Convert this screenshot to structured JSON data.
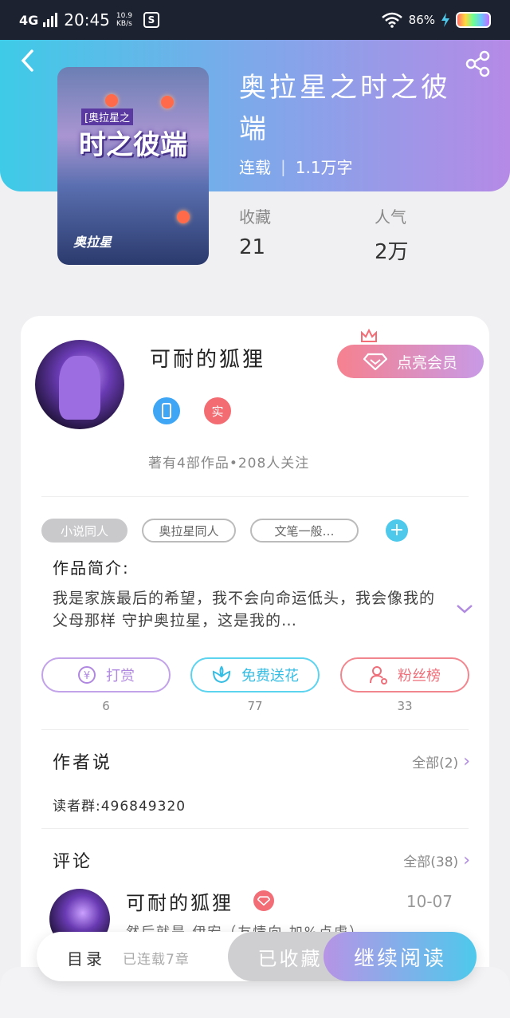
{
  "status_bar": {
    "network": "4G",
    "time": "20:45",
    "speed_value": "10.9",
    "speed_unit": "KB/s",
    "app_icon": "S",
    "battery": "86%"
  },
  "book": {
    "title": "奥拉星之时之彼端",
    "status": "连载",
    "word_count": "1.1万字",
    "favorites_label": "收藏",
    "favorites_value": "21",
    "popularity_label": "人气",
    "popularity_value": "2万",
    "cover": {
      "tag": "[奥拉星之",
      "title": "时之彼端",
      "logo": "奥拉星"
    }
  },
  "author": {
    "name": "可耐的狐狸",
    "vip_button": "点亮会员",
    "real_badge": "实",
    "stats": "著有4部作品•208人关注"
  },
  "tags": [
    "小说同人",
    "奥拉星同人",
    "文笔一般…"
  ],
  "tag_add": "+",
  "intro": {
    "title": "作品简介:",
    "text": "我是家族最后的希望，我不会向命运低头，我会像我的父母那样 守护奥拉星，这是我的…"
  },
  "actions": [
    {
      "label": "打赏",
      "count": "6"
    },
    {
      "label": "免费送花",
      "count": "77"
    },
    {
      "label": "粉丝榜",
      "count": "33"
    }
  ],
  "author_says": {
    "title": "作者说",
    "more": "全部(2)",
    "text": "读者群:496849320"
  },
  "comments": {
    "title": "评论",
    "more": "全部(38)",
    "first": {
      "name": "可耐的狐狸",
      "date": "10-07",
      "text": "然后就是 伊宏（友情向 加%点虐）"
    }
  },
  "bottom": {
    "toc": "目录",
    "serial_info": "已连载7章",
    "collected": "已收藏",
    "continue": "继续阅读"
  },
  "colors": {
    "header_start": "#3ecbe8",
    "header_end": "#b58ae6",
    "vip_pink": "#f6818f",
    "accent_cyan": "#4ec9ec"
  }
}
